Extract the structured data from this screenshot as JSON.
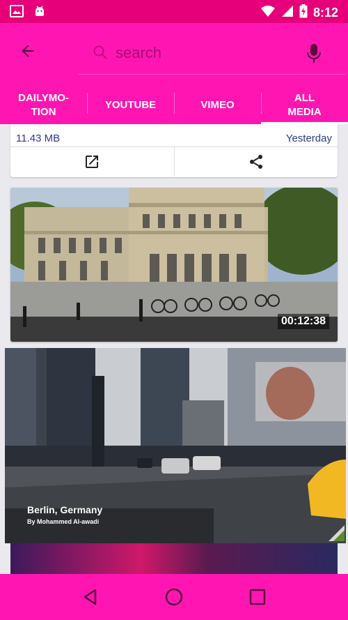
{
  "status_bar": {
    "time": "8:12",
    "icons": [
      "gallery-icon",
      "android-icon",
      "wifi-icon",
      "signal-icon",
      "battery-charging-icon"
    ]
  },
  "search": {
    "placeholder": "search"
  },
  "tabs": [
    {
      "label": "DAILYMO-\nTION",
      "active": false
    },
    {
      "label": "YOUTUBE",
      "active": false
    },
    {
      "label": "VIMEO",
      "active": false
    },
    {
      "label": "ALL\nMEDIA",
      "active": true
    }
  ],
  "media_items": [
    {
      "size": "11.43 MB",
      "date": "Yesterday"
    },
    {
      "duration": "00:12:38"
    }
  ],
  "floating_player": {
    "title": "Berlin, Germany",
    "author": "By Mohammed Al-awadi"
  },
  "colors": {
    "primary": "#ff16b2",
    "status_bar": "#e6007a",
    "meta_text": "#2b3a8c"
  }
}
